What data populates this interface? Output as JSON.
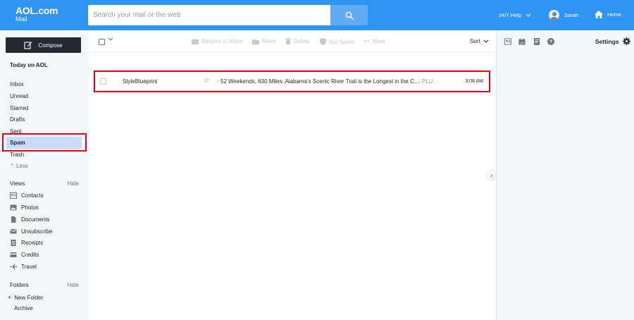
{
  "header": {
    "logo_line1": "AOL.com",
    "logo_line2": "Mail",
    "search_placeholder": "Search your mail or the web",
    "help_label": "24/7 Help",
    "user_name": "Sarah",
    "home_label": "Home",
    "brand_color": "#2f95f5"
  },
  "sidebar": {
    "compose_label": "Compose",
    "today_label": "Today on AOL",
    "folders": [
      {
        "label": "Inbox"
      },
      {
        "label": "Unread"
      },
      {
        "label": "Starred"
      },
      {
        "label": "Drafts"
      },
      {
        "label": "Sent"
      },
      {
        "label": "Spam",
        "selected": true
      },
      {
        "label": "Trash"
      }
    ],
    "less_label": "Less",
    "views_header": "Views",
    "views_hide": "Hide",
    "views": [
      {
        "label": "Contacts",
        "icon": "contacts-icon"
      },
      {
        "label": "Photos",
        "icon": "photos-icon"
      },
      {
        "label": "Documents",
        "icon": "documents-icon"
      },
      {
        "label": "Unsubscribe",
        "icon": "unsubscribe-icon"
      },
      {
        "label": "Receipts",
        "icon": "receipts-icon"
      },
      {
        "label": "Credits",
        "icon": "credits-icon"
      },
      {
        "label": "Travel",
        "icon": "travel-icon"
      }
    ],
    "folders_header": "Folders",
    "folders_hide": "Hide",
    "new_folder_label": "New Folder",
    "archive_label": "Archive"
  },
  "toolbar": {
    "restore_label": "Restore to Inbox",
    "move_label": "Move",
    "delete_label": "Delete",
    "not_spam_label": "Not Spam",
    "more_label": "More",
    "sort_label": "Sort"
  },
  "messages": [
    {
      "sender": "StyleBlueprint",
      "subject": "52 Weekends, 630 Miles: Alabama's Scenic River Trail is the Longest in the Count...",
      "preview": "PLU...",
      "time": "3:08 AM"
    }
  ],
  "right_panel": {
    "settings_label": "Settings"
  }
}
